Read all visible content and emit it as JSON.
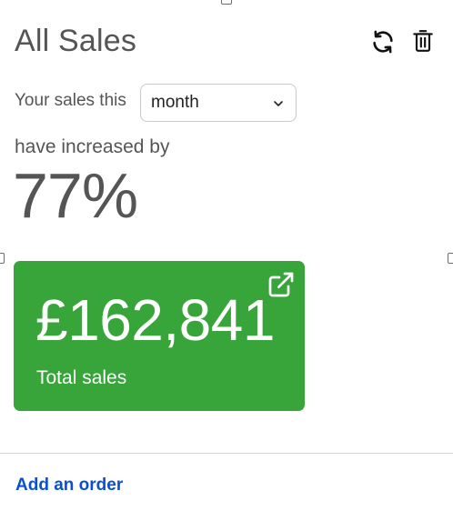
{
  "widget": {
    "title": "All Sales",
    "icons": {
      "refresh": "refresh-icon",
      "delete": "trash-icon"
    }
  },
  "summary": {
    "prefix": "Your sales this",
    "period_selected": "month",
    "suffix": "have increased by",
    "percent": "77%"
  },
  "card": {
    "amount": "£162,841",
    "label": "Total sales",
    "icon": "external-link-icon",
    "color": "#38a53a"
  },
  "footer": {
    "link_label": "Add an order",
    "link_color": "#0b4fd1"
  }
}
